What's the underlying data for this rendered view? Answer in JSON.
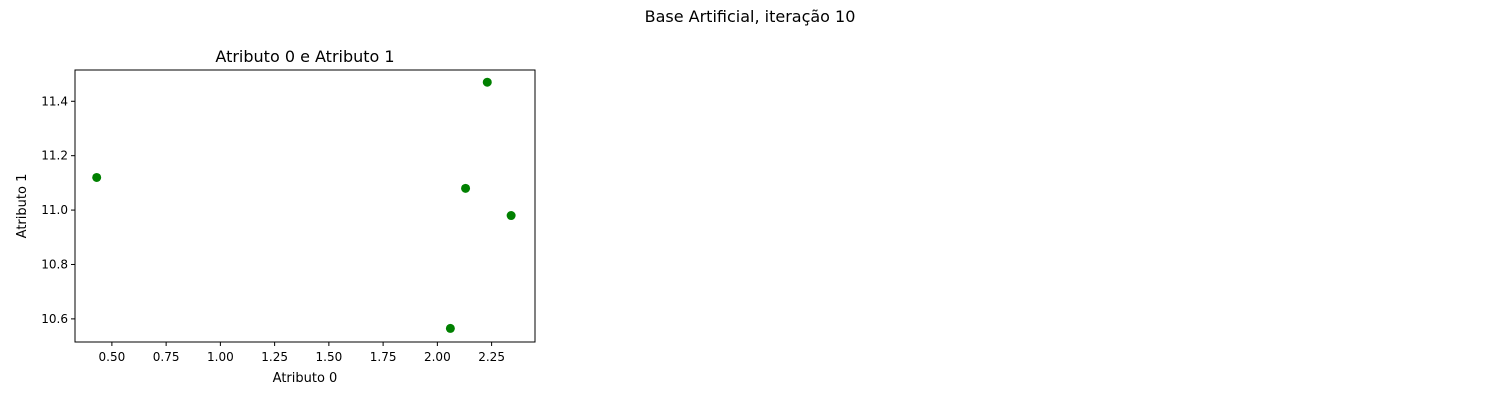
{
  "figure": {
    "suptitle": "Base Artificial, iteração 10"
  },
  "chart_data": {
    "type": "scatter",
    "title": "Atributo 0 e Atributo 1",
    "xlabel": "Atributo 0",
    "ylabel": "Atributo 1",
    "xlim": [
      0.33,
      2.45
    ],
    "ylim": [
      10.515,
      11.515
    ],
    "xticks": [
      0.5,
      0.75,
      1.0,
      1.25,
      1.5,
      1.75,
      2.0,
      2.25
    ],
    "xtick_labels": [
      "0.50",
      "0.75",
      "1.00",
      "1.25",
      "1.50",
      "1.75",
      "2.00",
      "2.25"
    ],
    "yticks": [
      10.6,
      10.8,
      11.0,
      11.2,
      11.4
    ],
    "ytick_labels": [
      "10.6",
      "10.8",
      "11.0",
      "11.2",
      "11.4"
    ],
    "grid": false,
    "series": [
      {
        "color": "#008000",
        "points": [
          {
            "x": 0.43,
            "y": 11.12
          },
          {
            "x": 2.23,
            "y": 11.47
          },
          {
            "x": 2.13,
            "y": 11.08
          },
          {
            "x": 2.34,
            "y": 10.98
          },
          {
            "x": 2.06,
            "y": 10.565
          }
        ]
      }
    ]
  }
}
